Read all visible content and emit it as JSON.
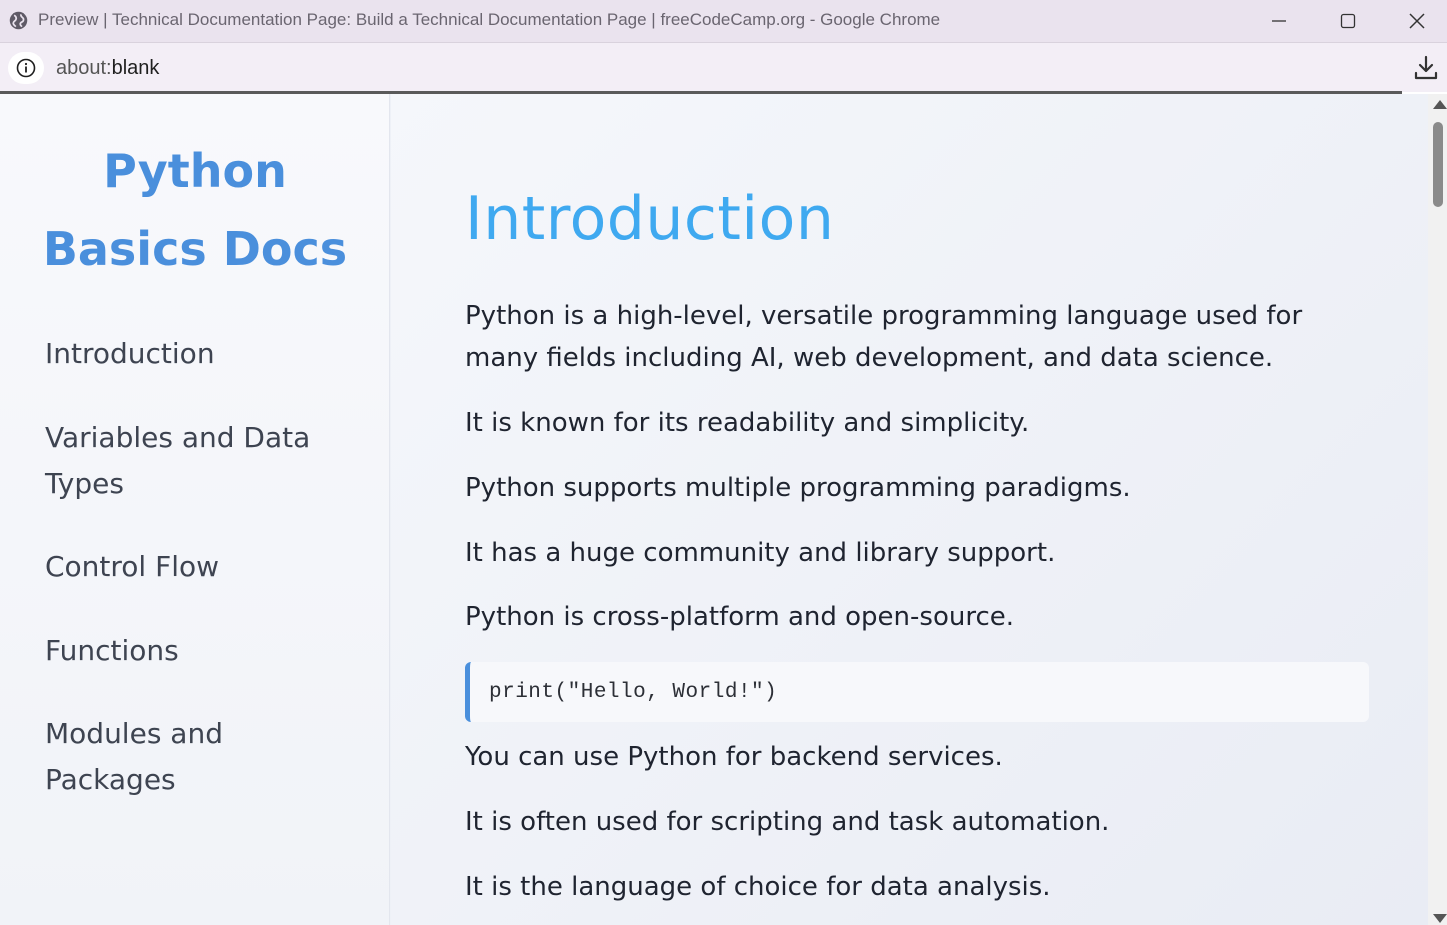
{
  "browser": {
    "window_title": "Preview | Technical Documentation Page: Build a Technical Documentation Page | freeCodeCamp.org - Google Chrome",
    "url_scheme": "about:",
    "url_rest": "blank"
  },
  "sidebar": {
    "title_line1": "Python",
    "title_line2": "Basics Docs",
    "nav": [
      {
        "label": "Introduction"
      },
      {
        "label": "Variables and Data Types"
      },
      {
        "label": "Control Flow"
      },
      {
        "label": "Functions"
      },
      {
        "label": "Modules and Packages"
      }
    ]
  },
  "main": {
    "heading": "Introduction",
    "paragraphs": [
      "Python is a high-level, versatile programming language used for many fields including AI, web development, and data science.",
      "It is known for its readability and simplicity.",
      "Python supports multiple programming paradigms.",
      "It has a huge community and library support.",
      "Python is cross-platform and open-source.",
      "You can use Python for backend services.",
      "It is often used for scripting and task automation.",
      "It is the language of choice for data analysis."
    ],
    "code": "print(\"Hello, World!\")"
  },
  "colors": {
    "accent": "#4a8fdc",
    "heading": "#3fa9f0",
    "titlebar": "#eae3ee"
  },
  "icons": [
    "globe-icon",
    "minimize-icon",
    "maximize-icon",
    "close-icon",
    "info-icon",
    "download-icon"
  ]
}
